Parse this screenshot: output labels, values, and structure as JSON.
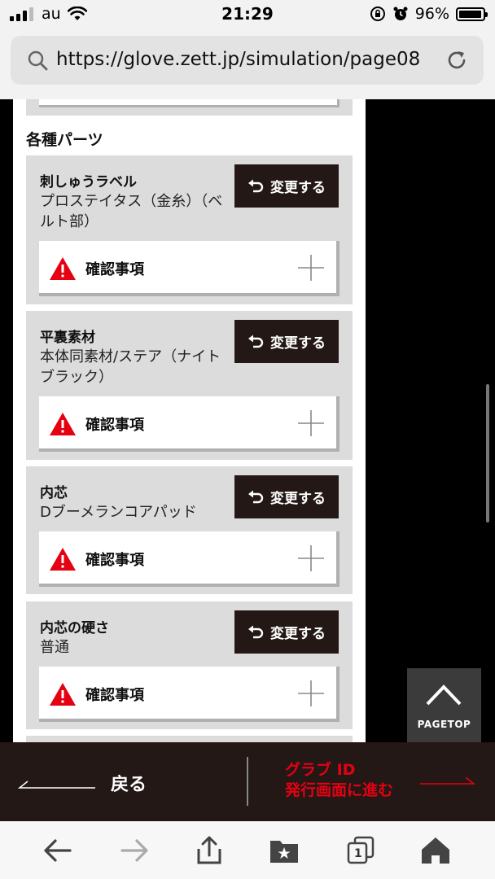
{
  "status_bar": {
    "carrier": "au",
    "time": "21:29",
    "battery": "96%",
    "battery_level": 0.96
  },
  "browser": {
    "url": "https://glove.zett.jp/simulation/page08",
    "tab_count": "1"
  },
  "section": {
    "title": "各種パーツ"
  },
  "parts": [
    {
      "name": "刺しゅうラベル",
      "value": "プロステイタス（金糸）（ベルト部）",
      "change_label": "変更する",
      "confirm_label": "確認事項"
    },
    {
      "name": "平裏素材",
      "value": "本体同素材/ステア（ナイトブラック）",
      "change_label": "変更する",
      "confirm_label": "確認事項"
    },
    {
      "name": "内芯",
      "value": "Dブーメランコアパッド",
      "change_label": "変更する",
      "confirm_label": "確認事項"
    },
    {
      "name": "内芯の硬さ",
      "value": "普通",
      "change_label": "変更する",
      "confirm_label": "確認事項"
    }
  ],
  "pagetop": {
    "label": "PAGETOP"
  },
  "bottom_nav": {
    "back_label": "戻る",
    "next_label_line1": "グラブ ID",
    "next_label_line2": "発行画面に進む"
  },
  "colors": {
    "dark_brown": "#231815",
    "accent_red": "#e50012",
    "card_gray": "#dcdcdc"
  }
}
